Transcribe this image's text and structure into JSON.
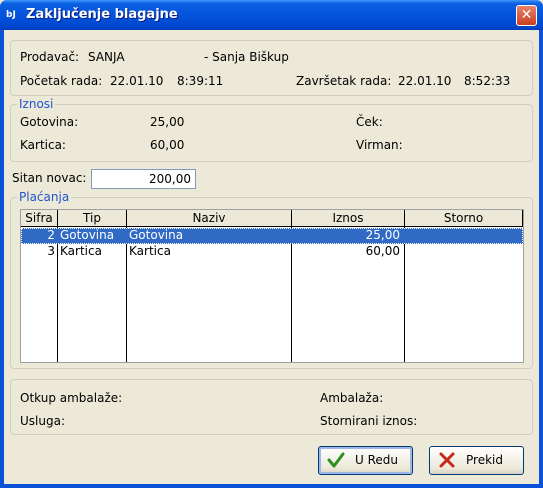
{
  "window": {
    "title": "Zaključenje blagajne",
    "icon_text": "bJ",
    "close_glyph": "✕"
  },
  "header": {
    "prodavac_label": "Prodavač:",
    "prodavac_value": "SANJA",
    "prodavac_name": "- Sanja Bišk­up",
    "pocetak_label": "Početak rada:",
    "pocetak_date": "22.01.10",
    "pocetak_time": "8:39:11",
    "zavrsetak_label": "Završetak rada:",
    "zavrsetak_date": "22.01.10",
    "zavrsetak_time": "8:52:33"
  },
  "iznosi": {
    "title": "Iznosi",
    "gotovina_label": "Gotovina:",
    "gotovina_value": "25,00",
    "kartica_label": "Kartica:",
    "kartica_value": "60,00",
    "cek_label": "Ček:",
    "virman_label": "Virman:"
  },
  "sitan_novac": {
    "label": "Sitan novac:",
    "value": "200,00"
  },
  "placanja": {
    "title": "Plaćanja",
    "columns": [
      "Sifra",
      "Tip",
      "Naziv",
      "Iznos",
      "Storno"
    ],
    "rows": [
      {
        "sifra": "2",
        "tip": "Gotovina",
        "naziv": "Gotovina",
        "iznos": "25,00",
        "storno": ""
      },
      {
        "sifra": "3",
        "tip": "Kartica",
        "naziv": "Kartica",
        "iznos": "60,00",
        "storno": ""
      }
    ]
  },
  "footer": {
    "otkup_label": "Otkup ambalaže:",
    "ambalaza_label": "Ambalaža:",
    "usluga_label": "Usluga:",
    "stornirani_label": "Stornirani iznos:"
  },
  "buttons": {
    "ok_label": "U Redu",
    "cancel_label": "Prekid"
  },
  "colors": {
    "selection": "#316ac5",
    "group_title": "#2154d1"
  }
}
